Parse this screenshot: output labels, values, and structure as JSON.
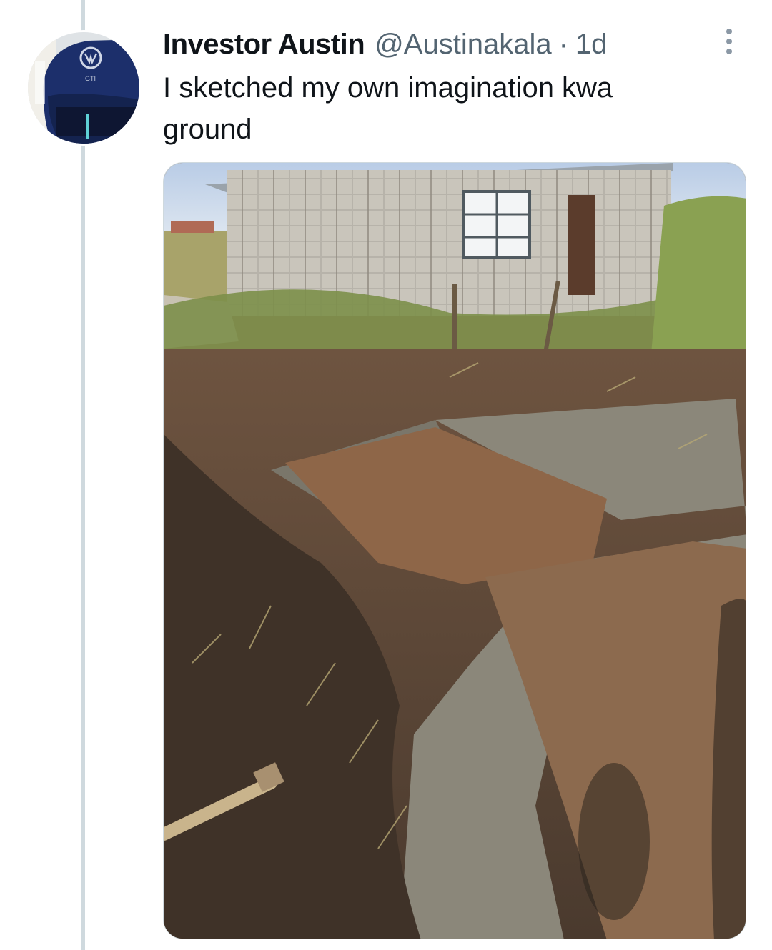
{
  "tweet": {
    "display_name": "Investor Austin",
    "handle": "@Austinakala",
    "separator": "·",
    "timestamp": "1d",
    "text": "I sketched my own imagination kwa\nground"
  },
  "avatar": {
    "badge_text": "GTI"
  },
  "icons": {
    "more": "more-vertical-icon",
    "avatar_logo": "vw-logo-icon"
  },
  "colors": {
    "text_primary": "#0f1419",
    "text_secondary": "#536471",
    "thread_line": "#cfd9de"
  }
}
